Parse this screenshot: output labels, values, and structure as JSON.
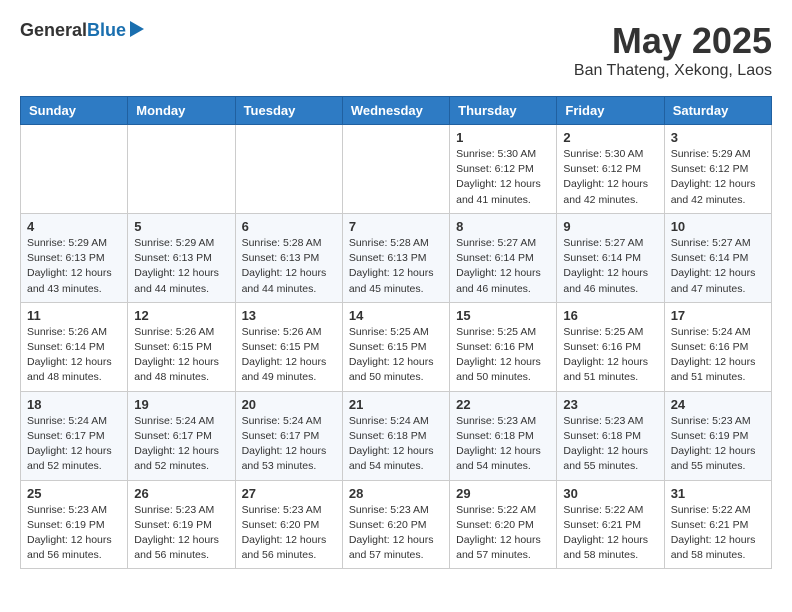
{
  "logo": {
    "general": "General",
    "blue": "Blue"
  },
  "title": {
    "month_year": "May 2025",
    "location": "Ban Thateng, Xekong, Laos"
  },
  "weekdays": [
    "Sunday",
    "Monday",
    "Tuesday",
    "Wednesday",
    "Thursday",
    "Friday",
    "Saturday"
  ],
  "weeks": [
    [
      {
        "day": "",
        "info": ""
      },
      {
        "day": "",
        "info": ""
      },
      {
        "day": "",
        "info": ""
      },
      {
        "day": "",
        "info": ""
      },
      {
        "day": "1",
        "info": "Sunrise: 5:30 AM\nSunset: 6:12 PM\nDaylight: 12 hours\nand 41 minutes."
      },
      {
        "day": "2",
        "info": "Sunrise: 5:30 AM\nSunset: 6:12 PM\nDaylight: 12 hours\nand 42 minutes."
      },
      {
        "day": "3",
        "info": "Sunrise: 5:29 AM\nSunset: 6:12 PM\nDaylight: 12 hours\nand 42 minutes."
      }
    ],
    [
      {
        "day": "4",
        "info": "Sunrise: 5:29 AM\nSunset: 6:13 PM\nDaylight: 12 hours\nand 43 minutes."
      },
      {
        "day": "5",
        "info": "Sunrise: 5:29 AM\nSunset: 6:13 PM\nDaylight: 12 hours\nand 44 minutes."
      },
      {
        "day": "6",
        "info": "Sunrise: 5:28 AM\nSunset: 6:13 PM\nDaylight: 12 hours\nand 44 minutes."
      },
      {
        "day": "7",
        "info": "Sunrise: 5:28 AM\nSunset: 6:13 PM\nDaylight: 12 hours\nand 45 minutes."
      },
      {
        "day": "8",
        "info": "Sunrise: 5:27 AM\nSunset: 6:14 PM\nDaylight: 12 hours\nand 46 minutes."
      },
      {
        "day": "9",
        "info": "Sunrise: 5:27 AM\nSunset: 6:14 PM\nDaylight: 12 hours\nand 46 minutes."
      },
      {
        "day": "10",
        "info": "Sunrise: 5:27 AM\nSunset: 6:14 PM\nDaylight: 12 hours\nand 47 minutes."
      }
    ],
    [
      {
        "day": "11",
        "info": "Sunrise: 5:26 AM\nSunset: 6:14 PM\nDaylight: 12 hours\nand 48 minutes."
      },
      {
        "day": "12",
        "info": "Sunrise: 5:26 AM\nSunset: 6:15 PM\nDaylight: 12 hours\nand 48 minutes."
      },
      {
        "day": "13",
        "info": "Sunrise: 5:26 AM\nSunset: 6:15 PM\nDaylight: 12 hours\nand 49 minutes."
      },
      {
        "day": "14",
        "info": "Sunrise: 5:25 AM\nSunset: 6:15 PM\nDaylight: 12 hours\nand 50 minutes."
      },
      {
        "day": "15",
        "info": "Sunrise: 5:25 AM\nSunset: 6:16 PM\nDaylight: 12 hours\nand 50 minutes."
      },
      {
        "day": "16",
        "info": "Sunrise: 5:25 AM\nSunset: 6:16 PM\nDaylight: 12 hours\nand 51 minutes."
      },
      {
        "day": "17",
        "info": "Sunrise: 5:24 AM\nSunset: 6:16 PM\nDaylight: 12 hours\nand 51 minutes."
      }
    ],
    [
      {
        "day": "18",
        "info": "Sunrise: 5:24 AM\nSunset: 6:17 PM\nDaylight: 12 hours\nand 52 minutes."
      },
      {
        "day": "19",
        "info": "Sunrise: 5:24 AM\nSunset: 6:17 PM\nDaylight: 12 hours\nand 52 minutes."
      },
      {
        "day": "20",
        "info": "Sunrise: 5:24 AM\nSunset: 6:17 PM\nDaylight: 12 hours\nand 53 minutes."
      },
      {
        "day": "21",
        "info": "Sunrise: 5:24 AM\nSunset: 6:18 PM\nDaylight: 12 hours\nand 54 minutes."
      },
      {
        "day": "22",
        "info": "Sunrise: 5:23 AM\nSunset: 6:18 PM\nDaylight: 12 hours\nand 54 minutes."
      },
      {
        "day": "23",
        "info": "Sunrise: 5:23 AM\nSunset: 6:18 PM\nDaylight: 12 hours\nand 55 minutes."
      },
      {
        "day": "24",
        "info": "Sunrise: 5:23 AM\nSunset: 6:19 PM\nDaylight: 12 hours\nand 55 minutes."
      }
    ],
    [
      {
        "day": "25",
        "info": "Sunrise: 5:23 AM\nSunset: 6:19 PM\nDaylight: 12 hours\nand 56 minutes."
      },
      {
        "day": "26",
        "info": "Sunrise: 5:23 AM\nSunset: 6:19 PM\nDaylight: 12 hours\nand 56 minutes."
      },
      {
        "day": "27",
        "info": "Sunrise: 5:23 AM\nSunset: 6:20 PM\nDaylight: 12 hours\nand 56 minutes."
      },
      {
        "day": "28",
        "info": "Sunrise: 5:23 AM\nSunset: 6:20 PM\nDaylight: 12 hours\nand 57 minutes."
      },
      {
        "day": "29",
        "info": "Sunrise: 5:22 AM\nSunset: 6:20 PM\nDaylight: 12 hours\nand 57 minutes."
      },
      {
        "day": "30",
        "info": "Sunrise: 5:22 AM\nSunset: 6:21 PM\nDaylight: 12 hours\nand 58 minutes."
      },
      {
        "day": "31",
        "info": "Sunrise: 5:22 AM\nSunset: 6:21 PM\nDaylight: 12 hours\nand 58 minutes."
      }
    ]
  ]
}
